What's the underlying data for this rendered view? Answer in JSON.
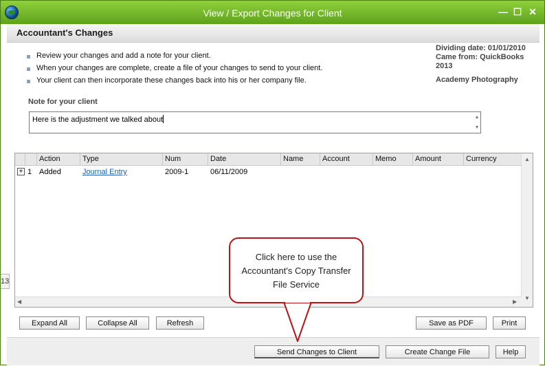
{
  "window": {
    "title": "View / Export Changes for Client",
    "controls": [
      "—",
      "☐",
      "✕"
    ]
  },
  "header": {
    "title": "Accountant's Changes"
  },
  "instructions": [
    "Review your changes and add a note for your client.",
    "When your changes are complete, create a file of your changes to send to your client.",
    "Your client can then incorporate these changes back into his or her company file."
  ],
  "info": {
    "dividing_date": "Dividing date: 01/01/2010",
    "came_from_line1": "Came from: QuickBooks",
    "came_from_line2": "2013",
    "company": "Academy Photography"
  },
  "note": {
    "label": "Note for your client",
    "value": "Here is the adjustment we talked about"
  },
  "table": {
    "columns": [
      "Action",
      "Type",
      "Num",
      "Date",
      "Name",
      "Account",
      "Memo",
      "Amount",
      "Currency"
    ],
    "rows": [
      {
        "index": "1",
        "action": "Added",
        "type": "Journal Entry",
        "num": "2009-1",
        "date": "06/11/2009",
        "name": "",
        "account": "",
        "memo": "",
        "amount": "",
        "currency": ""
      }
    ]
  },
  "side_tab": {
    "label": "13"
  },
  "buttons": {
    "expand_all": "Expand All",
    "collapse_all": "Collapse All",
    "refresh": "Refresh",
    "save_pdf": "Save as PDF",
    "print": "Print",
    "send_changes": "Send Changes to Client",
    "create_file": "Create Change File",
    "help": "Help"
  },
  "callout": {
    "line1": "Click here to use the",
    "line2": "Accountant's Copy Transfer",
    "line3": "File Service"
  },
  "colors": {
    "titlebar": "#6db32a",
    "callout_border": "#b81414",
    "link": "#1f5fb5"
  },
  "icons": [
    "app-globe-icon",
    "minimize-icon",
    "maximize-icon",
    "close-icon",
    "expand-plus-icon"
  ]
}
